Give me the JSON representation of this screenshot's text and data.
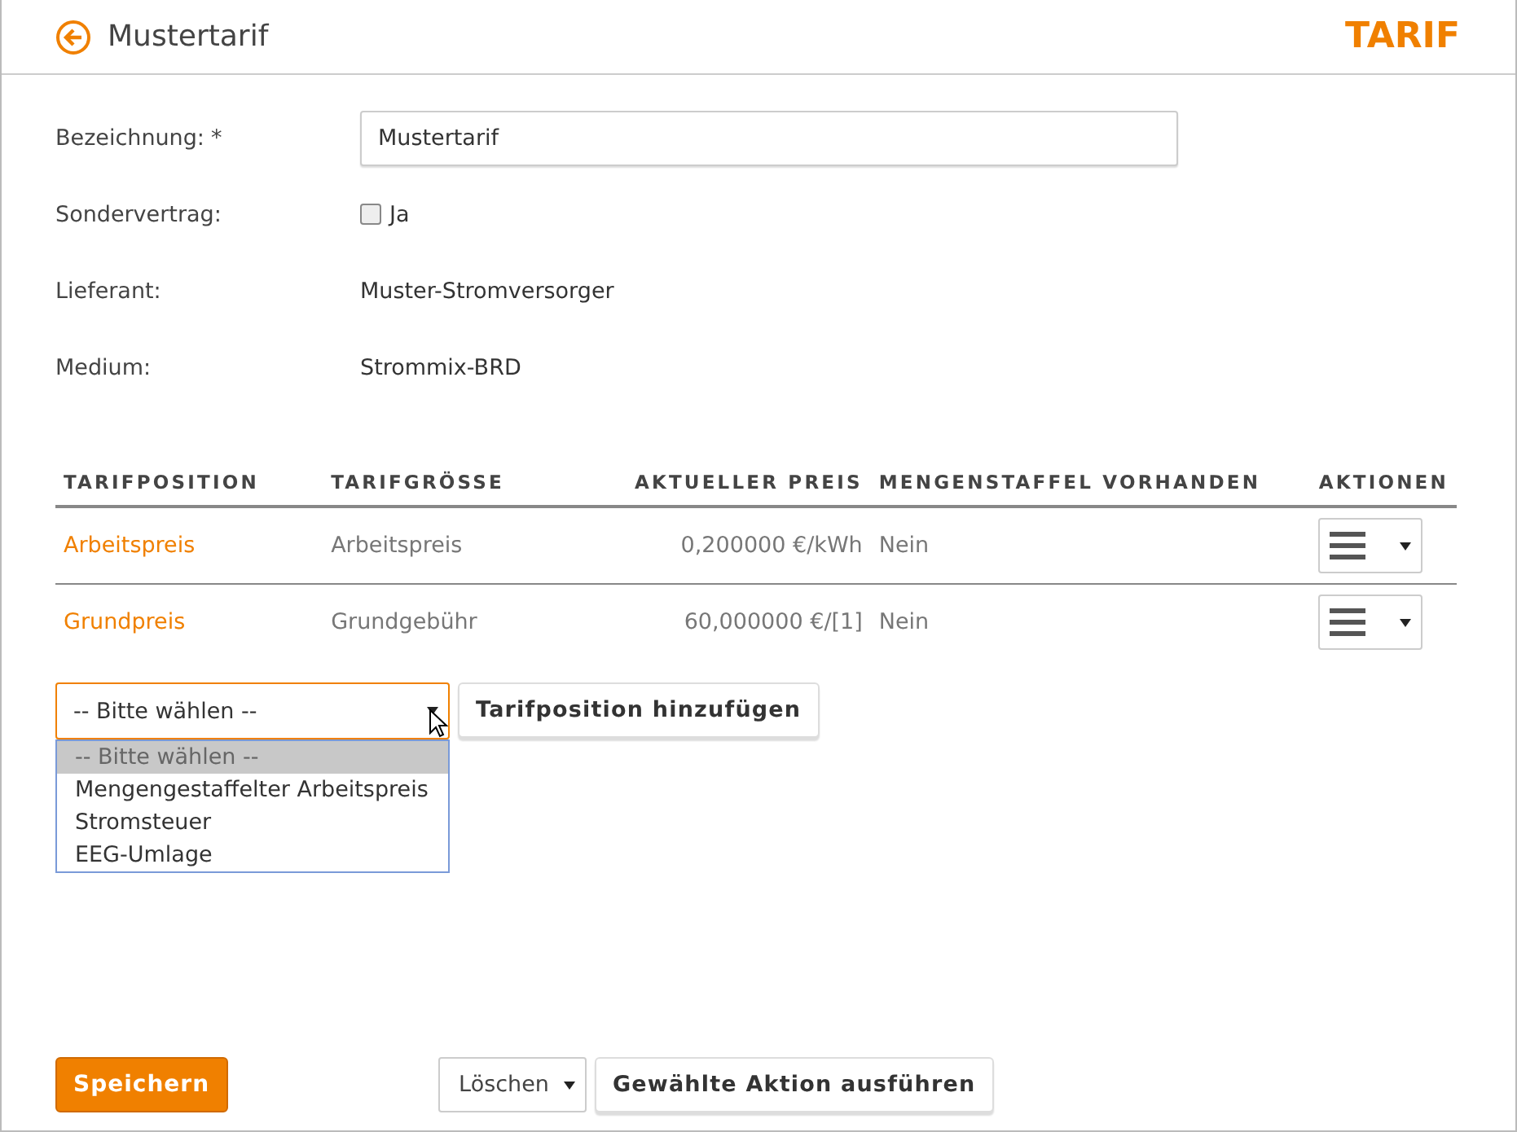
{
  "header": {
    "title": "Mustertarif",
    "badge": "TARIF"
  },
  "form": [
    {
      "kind": "input",
      "label": "Bezeichnung:",
      "required_mark": "*",
      "value": "Mustertarif"
    },
    {
      "kind": "checkbox",
      "label": "Sondervertrag:",
      "option": "Ja",
      "checked": false
    },
    {
      "kind": "text",
      "label": "Lieferant:",
      "value": "Muster-Stromversorger"
    },
    {
      "kind": "text",
      "label": "Medium:",
      "value": "Strommix-BRD"
    }
  ],
  "table": {
    "columns": [
      "TARIFPOSITION",
      "TARIFGRÖSSE",
      "AKTUELLER PREIS",
      "MENGENSTAFFEL VORHANDEN",
      "AKTIONEN"
    ],
    "rows": [
      {
        "position": "Arbeitspreis",
        "size": "Arbeitspreis",
        "price": "0,200000 €/kWh",
        "staffel": "Nein"
      },
      {
        "position": "Grundpreis",
        "size": "Grundgebühr",
        "price": "60,000000 €/[1]",
        "staffel": "Nein"
      }
    ]
  },
  "add": {
    "select": {
      "value": "-- Bitte wählen --",
      "expanded": true,
      "options": [
        {
          "label": "-- Bitte wählen --",
          "selected": true
        },
        {
          "label": "Mengengestaffelter Arbeitspreis",
          "selected": false
        },
        {
          "label": "Stromsteuer",
          "selected": false
        },
        {
          "label": "EEG-Umlage",
          "selected": false
        }
      ]
    },
    "button": "Tarifposition hinzufügen"
  },
  "footer": {
    "save": "Speichern",
    "action_select": "Löschen",
    "execute": "Gewählte Aktion ausführen"
  }
}
